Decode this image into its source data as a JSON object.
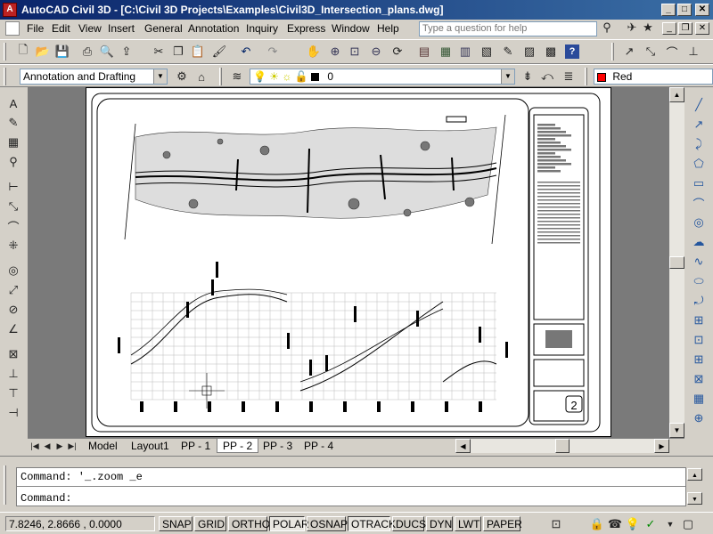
{
  "window": {
    "title": "AutoCAD Civil 3D - [C:\\Civil 3D Projects\\Examples\\Civil3D_Intersection_plans.dwg]",
    "minimize_glyph": "_",
    "maximize_glyph": "□",
    "close_glyph": "✕"
  },
  "menu": {
    "items": [
      "File",
      "Edit",
      "View",
      "Insert",
      "General",
      "Annotation",
      "Inquiry",
      "Express",
      "Window",
      "Help"
    ],
    "help_placeholder": "Type a question for help"
  },
  "workspace": {
    "name": "Annotation and Drafting"
  },
  "layer": {
    "current": "0"
  },
  "color_control": {
    "current": "Red",
    "swatch_color": "#ff0000"
  },
  "layout_tabs": [
    "Model",
    "Layout1",
    "PP - 1",
    "PP - 2",
    "PP - 3",
    "PP - 4"
  ],
  "active_tab_index": 3,
  "command": {
    "history_line": "Command: '_.zoom _e",
    "prompt_line": "Command:"
  },
  "status": {
    "coordinates": "7.8246, 2.8666 , 0.0000",
    "toggles": [
      "SNAP",
      "GRID",
      "ORTHO",
      "POLAR",
      "OSNAP",
      "OTRACK",
      "DUCS",
      "DYN",
      "LWT",
      "PAPER"
    ],
    "toggles_on": [
      "POLAR",
      "OTRACK"
    ]
  },
  "sheet": {
    "page_number": "2",
    "tool_glyphs": [
      "A",
      "✎",
      "▦",
      "⚲",
      "⊢",
      "⤡",
      "⌒",
      "⁜",
      "◎",
      "⤢",
      "⊘",
      "∠",
      "⊠",
      "⊥",
      "⊤",
      "⊣"
    ],
    "draw_glyphs": [
      "╱",
      "↗",
      "⤸",
      "⬠",
      "▭",
      "⌒",
      "◎",
      "☁",
      "∿",
      "⬭",
      "⤾",
      "⊞",
      "⊡",
      "⊞",
      "⊠",
      "▦",
      "⊕"
    ]
  }
}
